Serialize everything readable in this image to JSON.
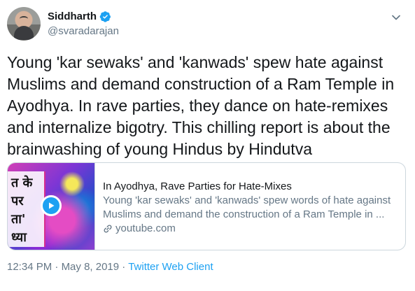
{
  "author": {
    "display_name": "Siddharth",
    "handle": "@svaradarajan",
    "verified": true
  },
  "icons": {
    "verified": "verified-badge-icon",
    "more": "chevron-down-icon",
    "play": "play-icon",
    "link": "link-icon"
  },
  "colors": {
    "accent": "#1da1f2",
    "text_primary": "#14171a",
    "text_secondary": "#657786",
    "border": "#ccd6dd"
  },
  "tweet": {
    "text": "Young 'kar sewaks' and 'kanwads' spew hate against Muslims and demand construction of a Ram Temple in Ayodhya. In rave parties, they dance on hate-remixes and internalize bigotry. This chilling report is about the brainwashing of young Hindus by Hindutva"
  },
  "card": {
    "thumbnail_text": [
      "त के",
      "पर",
      "ता'",
      "ध्या"
    ],
    "title": "In Ayodhya, Rave Parties for Hate-Mixes",
    "description": "Young 'kar sewaks' and 'kanwads' spew words of hate against Muslims and demand the construction of a Ram Temple in ...",
    "domain": "youtube.com"
  },
  "meta": {
    "time": "12:34 PM",
    "separator_1": " · ",
    "date": "May 8, 2019",
    "separator_2": " · ",
    "source": "Twitter Web Client"
  }
}
